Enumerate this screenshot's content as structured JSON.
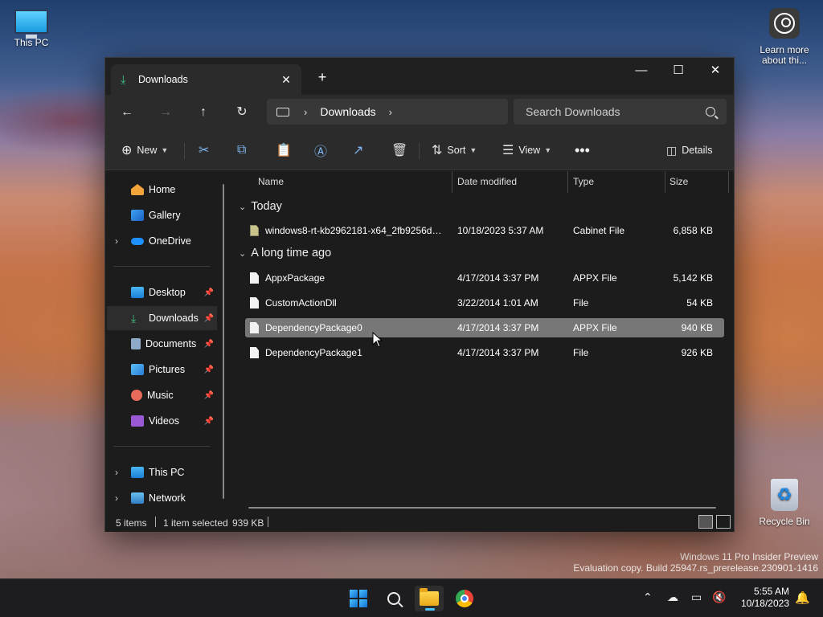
{
  "desktop": {
    "this_pc_label": "This PC",
    "learn_more_label": "Learn more about thi...",
    "recycle_bin_label": "Recycle Bin",
    "watermark_line1": "Windows 11 Pro Insider Preview",
    "watermark_line2": "Evaluation copy. Build 25947.rs_prerelease.230901-1416"
  },
  "window": {
    "tab_title": "Downloads",
    "address": {
      "location": "Downloads"
    },
    "search": {
      "placeholder": "Search Downloads"
    },
    "toolbar": {
      "new_label": "New",
      "sort_label": "Sort",
      "view_label": "View",
      "details_label": "Details"
    },
    "sidebar": {
      "home": "Home",
      "gallery": "Gallery",
      "onedrive": "OneDrive",
      "desktop": "Desktop",
      "downloads": "Downloads",
      "documents": "Documents",
      "pictures": "Pictures",
      "music": "Music",
      "videos": "Videos",
      "this_pc": "This PC",
      "network": "Network"
    },
    "columns": {
      "name": "Name",
      "date": "Date modified",
      "type": "Type",
      "size": "Size"
    },
    "groups": {
      "today": "Today",
      "long_ago": "A long time ago"
    },
    "files": [
      {
        "name": "windows8-rt-kb2962181-x64_2fb9256d6b...",
        "date": "10/18/2023 5:37 AM",
        "type": "Cabinet File",
        "size": "6,858 KB"
      },
      {
        "name": "AppxPackage",
        "date": "4/17/2014 3:37 PM",
        "type": "APPX File",
        "size": "5,142 KB"
      },
      {
        "name": "CustomActionDll",
        "date": "3/22/2014 1:01 AM",
        "type": "File",
        "size": "54 KB"
      },
      {
        "name": "DependencyPackage0",
        "date": "4/17/2014 3:37 PM",
        "type": "APPX File",
        "size": "940 KB"
      },
      {
        "name": "DependencyPackage1",
        "date": "4/17/2014 3:37 PM",
        "type": "File",
        "size": "926 KB"
      }
    ],
    "status": {
      "items": "5 items",
      "selected": "1 item selected",
      "size": "939 KB"
    }
  },
  "taskbar": {
    "time": "5:55 AM",
    "date": "10/18/2023"
  },
  "colors": {
    "accent": "#4cc2ff",
    "selected_row": "#777777",
    "window_bg": "#1c1c1c"
  }
}
